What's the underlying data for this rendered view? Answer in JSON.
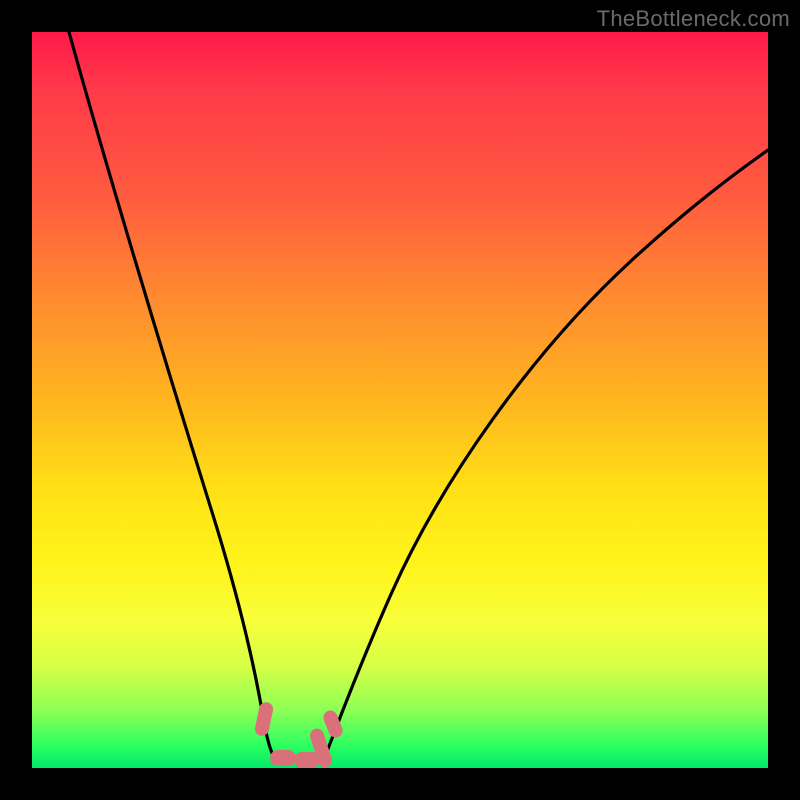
{
  "watermark": "TheBottleneck.com",
  "chart_data": {
    "type": "line",
    "title": "",
    "xlabel": "",
    "ylabel": "",
    "xlim": [
      0,
      100
    ],
    "ylim": [
      0,
      100
    ],
    "grid": false,
    "series": [
      {
        "name": "left-curve",
        "x": [
          5,
          8,
          12,
          16,
          20,
          24,
          26,
          28,
          30,
          31
        ],
        "y": [
          100,
          88,
          72,
          55,
          38,
          22,
          14,
          8,
          3,
          1
        ]
      },
      {
        "name": "right-curve",
        "x": [
          37,
          40,
          44,
          50,
          58,
          68,
          80,
          92,
          100
        ],
        "y": [
          1,
          5,
          12,
          23,
          37,
          52,
          66,
          77,
          84
        ]
      },
      {
        "name": "highlight-band",
        "x": [
          29,
          37.5
        ],
        "y": [
          0,
          0
        ],
        "note": "pink rounded markers along bottom between curve minima"
      }
    ],
    "colors": {
      "curve": "#000000",
      "highlight": "#d9707a",
      "gradient_top": "#ff1a4a",
      "gradient_mid": "#ffe015",
      "gradient_bottom": "#00e86a"
    }
  }
}
